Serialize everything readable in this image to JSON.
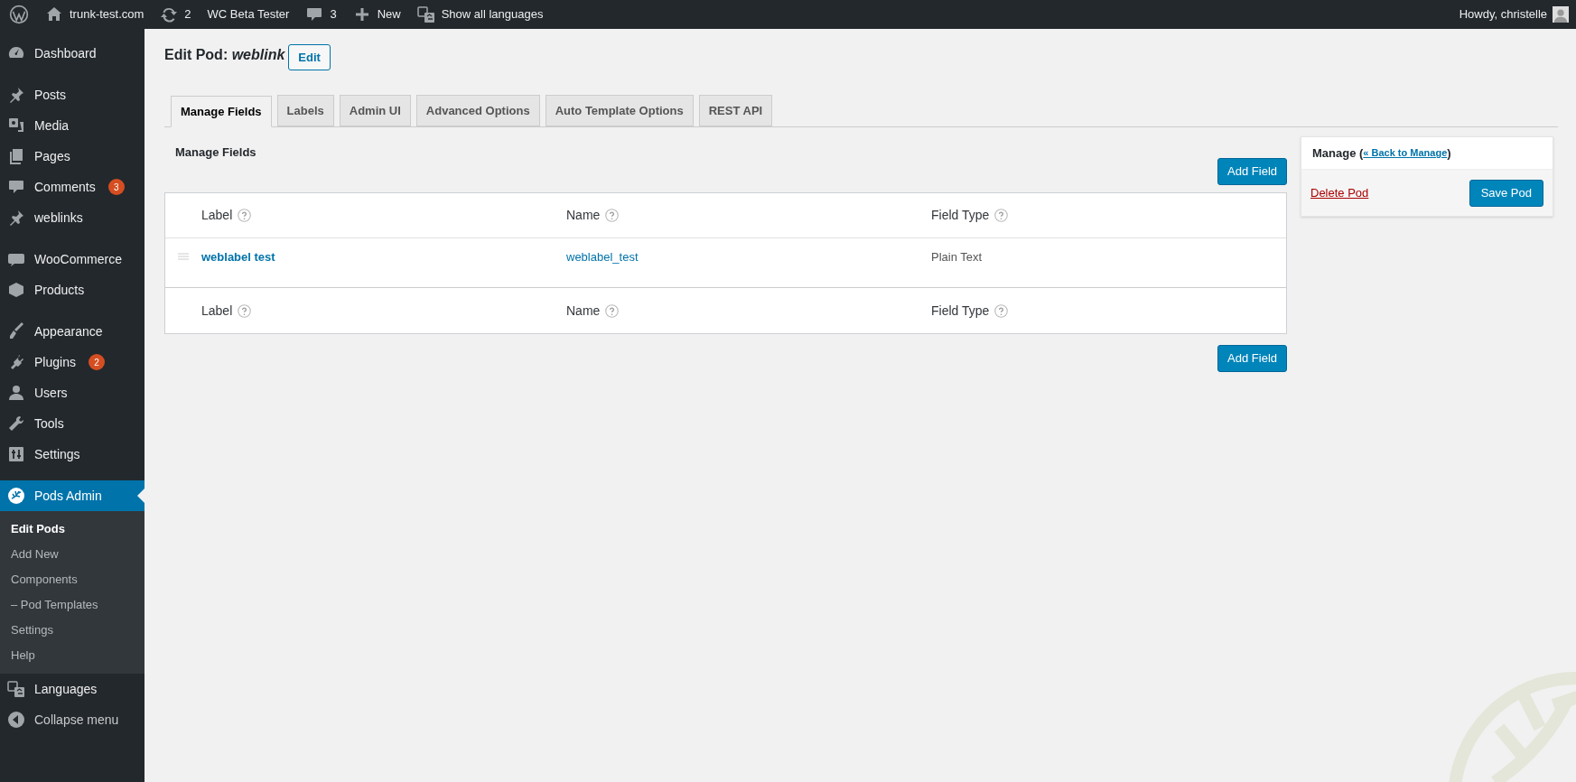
{
  "admin_bar": {
    "items": [
      {
        "kind": "logo"
      },
      {
        "text": "trunk-test.com"
      },
      {
        "text": "2"
      },
      {
        "text": "WC Beta Tester"
      },
      {
        "text": "3"
      },
      {
        "text": "New"
      },
      {
        "text": "Show all languages"
      }
    ],
    "greeting": "Howdy, christelle"
  },
  "sidebar": {
    "groups": [
      [
        {
          "label": "Dashboard",
          "selected": false
        }
      ],
      [
        {
          "label": "Posts",
          "selected": false
        },
        {
          "label": "Media",
          "selected": false
        },
        {
          "label": "Pages",
          "selected": false
        },
        {
          "label": "Comments",
          "badge": "3",
          "selected": false
        },
        {
          "label": "weblinks",
          "selected": false
        }
      ],
      [
        {
          "label": "WooCommerce",
          "selected": false
        },
        {
          "label": "Products",
          "selected": false
        }
      ],
      [
        {
          "label": "Appearance",
          "selected": false
        },
        {
          "label": "Plugins",
          "badge": "2",
          "selected": false
        },
        {
          "label": "Users",
          "selected": false
        },
        {
          "label": "Tools",
          "selected": false
        },
        {
          "label": "Settings",
          "selected": false
        }
      ],
      [
        {
          "label": "Pods Admin",
          "selected": true,
          "children": [
            {
              "label": "Edit Pods",
              "selected": true
            },
            {
              "label": "Add New",
              "selected": false
            },
            {
              "label": "Components",
              "selected": false
            },
            {
              "label": "– Pod Templates",
              "selected": false
            },
            {
              "label": "Settings",
              "selected": false
            },
            {
              "label": "Help",
              "selected": false
            }
          ]
        },
        {
          "label": "Languages",
          "selected": false
        },
        {
          "label": "Collapse menu",
          "selected": false
        }
      ]
    ]
  },
  "page": {
    "title": "Edit Pod:",
    "pod_name": "weblink",
    "edit_button": "Edit"
  },
  "tabs": [
    {
      "label": "Manage Fields",
      "selected": true
    },
    {
      "label": "Labels",
      "selected": false
    },
    {
      "label": "Admin UI",
      "selected": false
    },
    {
      "label": "Advanced Options",
      "selected": false
    },
    {
      "label": "Auto Template Options",
      "selected": false
    },
    {
      "label": "REST API",
      "selected": false
    }
  ],
  "section_title": "Manage Fields",
  "add_field_buttons": [
    "Add Field",
    "Add Field"
  ],
  "table": {
    "header": [
      "Label",
      "Name",
      "Field Type"
    ],
    "rows": [
      {
        "label": "weblabel test",
        "name": "weblabel_test",
        "type": "Plain Text"
      }
    ],
    "footer": [
      "Label",
      "Name",
      "Field Type"
    ]
  },
  "manage_box": {
    "title": "Manage (",
    "back_link": "« Back to Manage",
    "close_paren": ")",
    "delete_link": "Delete Pod",
    "save_button": "Save Pod"
  }
}
